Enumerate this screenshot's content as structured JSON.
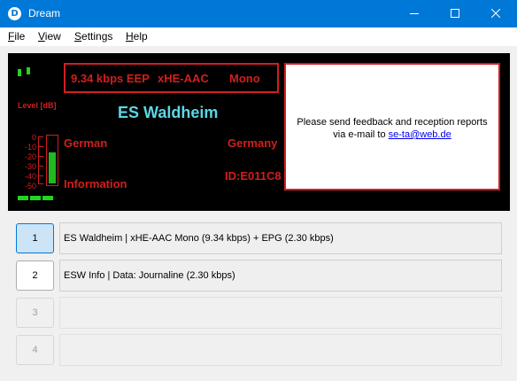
{
  "window": {
    "title": "Dream",
    "app_icon_letter": "D",
    "minimize_icon": "minimize-icon",
    "maximize_icon": "maximize-icon",
    "close_icon": "close-icon"
  },
  "menu": {
    "items": [
      {
        "mnemonic": "F",
        "rest": "ile"
      },
      {
        "mnemonic": "V",
        "rest": "iew"
      },
      {
        "mnemonic": "S",
        "rest": "ettings"
      },
      {
        "mnemonic": "H",
        "rest": "elp"
      }
    ]
  },
  "display": {
    "bitrate": "9.34 kbps EEP",
    "codec": "xHE-AAC",
    "audio_mode": "Mono",
    "station_name": "ES Waldheim",
    "language": "German",
    "country": "Germany",
    "program_type": "Information",
    "service_id": "ID:E011C8",
    "level_label": "Level [dB]",
    "level_ticks": [
      "0",
      "-10",
      "-20",
      "-30",
      "-40",
      "-50"
    ],
    "level_fill_fraction": 0.63,
    "colors": {
      "text": "#d31e1e",
      "station": "#5ad8e6",
      "led": "#22d422",
      "background": "#000000"
    }
  },
  "message": {
    "text": "Please send feedback and reception reports via e-mail to",
    "email": "se-ta@web.de"
  },
  "services": [
    {
      "number": "1",
      "label": "ES Waldheim  |  xHE-AAC Mono (9.34 kbps) + EPG (2.30 kbps)",
      "state": "active"
    },
    {
      "number": "2",
      "label": "ESW Info  |  Data: Journaline (2.30 kbps)",
      "state": "enabled"
    },
    {
      "number": "3",
      "label": "",
      "state": "disabled"
    },
    {
      "number": "4",
      "label": "",
      "state": "disabled"
    }
  ]
}
